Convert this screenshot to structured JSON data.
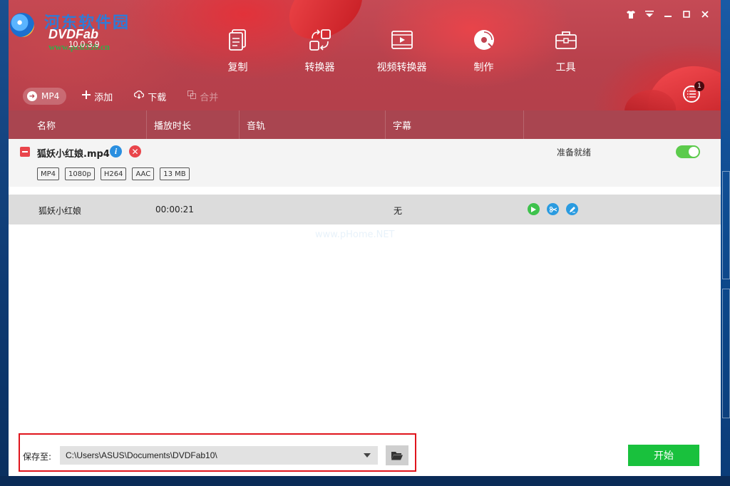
{
  "logo": {
    "site_watermark": "河东软件园",
    "brand": "DVDFab",
    "version": "10.0.3.9",
    "url_watermark": "www.pc0359.cn"
  },
  "window_controls": [
    "shirt-icon",
    "menu-icon",
    "minimize-icon",
    "maximize-icon",
    "close-icon"
  ],
  "nav": [
    {
      "label": "复制",
      "icon": "copy-icon"
    },
    {
      "label": "转换器",
      "icon": "ripper-icon"
    },
    {
      "label": "视频转换器",
      "icon": "video-converter-icon"
    },
    {
      "label": "制作",
      "icon": "creator-icon"
    },
    {
      "label": "工具",
      "icon": "toolbox-icon"
    }
  ],
  "toolbar": {
    "profile": "MP4",
    "add": "添加",
    "download": "下载",
    "merge": "合并",
    "queue_count": "1"
  },
  "columns": [
    "名称",
    "播放时长",
    "音轨",
    "字幕"
  ],
  "file": {
    "name": "狐妖小红娘.mp4",
    "status": "准备就绪",
    "tags": [
      "MP4",
      "1080p",
      "H264",
      "AAC",
      "13 MB"
    ]
  },
  "track": {
    "title": "狐妖小红娘",
    "duration": "00:00:21",
    "subtitle": "无"
  },
  "watermark2": "www.pHome.NET",
  "footer": {
    "save_label": "保存至:",
    "path": "C:\\Users\\ASUS\\Documents\\DVDFab10\\",
    "start": "开始"
  },
  "colors": {
    "banner": "#b8414c",
    "header_row": "#a94550",
    "start_button": "#19c13d",
    "highlight_box": "#e0141c",
    "toggle_on": "#5ccb4c"
  }
}
